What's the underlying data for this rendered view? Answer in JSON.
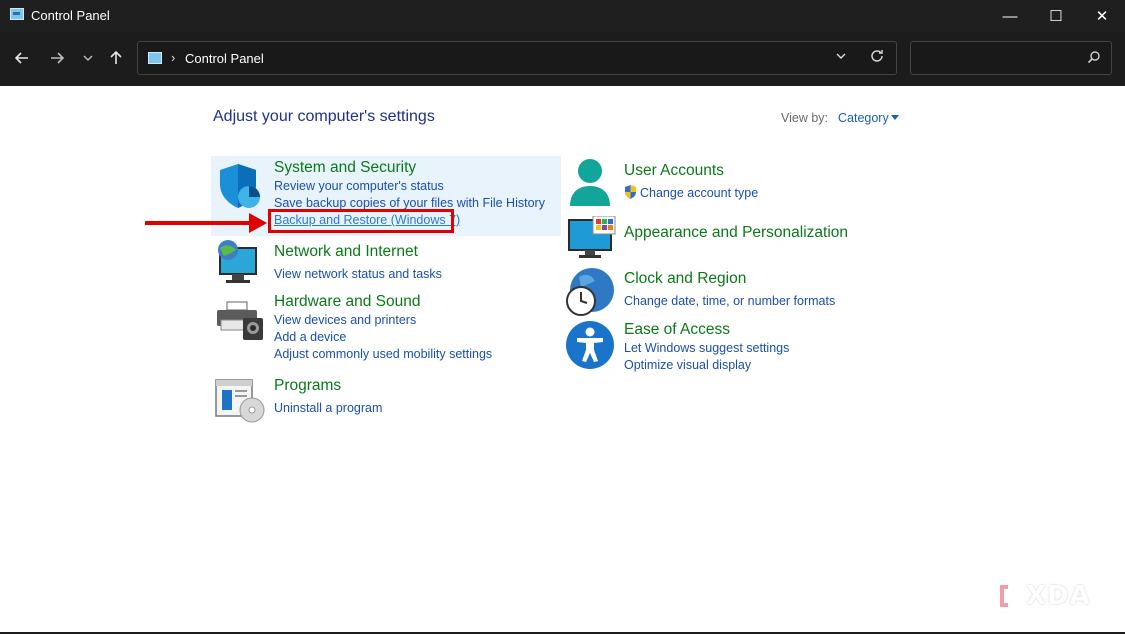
{
  "window": {
    "title": "Control Panel",
    "minimize_glyph": "—",
    "maximize_glyph": "☐",
    "close_glyph": "✕"
  },
  "address": {
    "path": "Control Panel",
    "separator": "›",
    "search_placeholder": ""
  },
  "header": {
    "heading": "Adjust your computer's settings",
    "view_by_label": "View by:",
    "view_by_value": "Category"
  },
  "categories": {
    "system_security": {
      "title": "System and Security",
      "links": [
        "Review your computer's status",
        "Save backup copies of your files with File History",
        "Backup and Restore (Windows 7)"
      ]
    },
    "network": {
      "title": "Network and Internet",
      "links": [
        "View network status and tasks"
      ]
    },
    "hardware": {
      "title": "Hardware and Sound",
      "links": [
        "View devices and printers",
        "Add a device",
        "Adjust commonly used mobility settings"
      ]
    },
    "programs": {
      "title": "Programs",
      "links": [
        "Uninstall a program"
      ]
    },
    "user_accounts": {
      "title": "User Accounts",
      "links": [
        "Change account type"
      ]
    },
    "appearance": {
      "title": "Appearance and Personalization",
      "links": []
    },
    "clock": {
      "title": "Clock and Region",
      "links": [
        "Change date, time, or number formats"
      ]
    },
    "ease": {
      "title": "Ease of Access",
      "links": [
        "Let Windows suggest settings",
        "Optimize visual display"
      ]
    }
  },
  "watermark": {
    "text": "XDA"
  },
  "colors": {
    "title_green": "#0a7a19",
    "link_blue": "#1a4fb0",
    "heading_blue": "#1e3287",
    "highlight_bg": "#e8f3fc",
    "annotation_red": "#e00000",
    "titlebar_bg": "#1f1f1f"
  }
}
